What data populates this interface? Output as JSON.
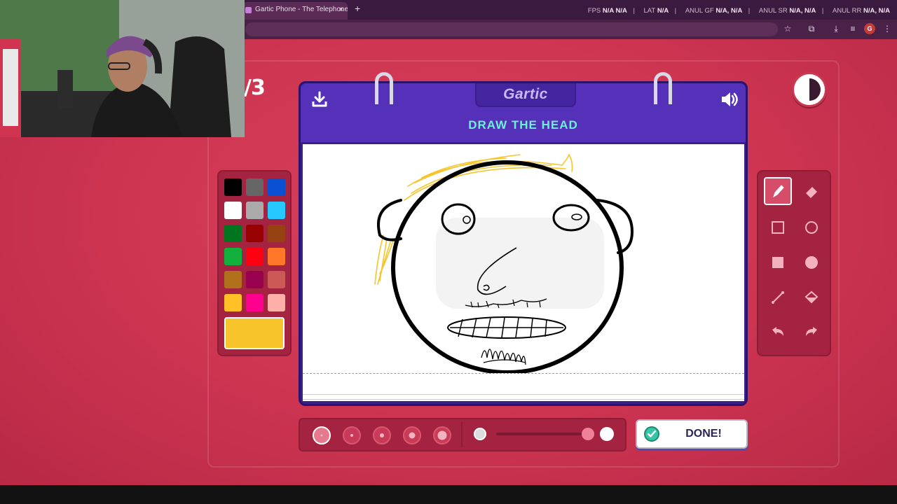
{
  "browser": {
    "tab_title": "Gartic Phone - The Telephone G",
    "tab_close": "×",
    "new_tab": "+",
    "stats": [
      {
        "label": "FPS",
        "value": "N/A  N/A"
      },
      {
        "label": "LAT",
        "value": "N/A"
      },
      {
        "label": "ANUL GF",
        "value": "N/A, N/A"
      },
      {
        "label": "ANUL SR",
        "value": "N/A, N/A"
      },
      {
        "label": "ANUL RR",
        "value": "N/A, N/A"
      }
    ],
    "profile_initial": "G"
  },
  "game": {
    "round_counter": "/3",
    "logo": "Gartic",
    "prompt": "DRAW THE HEAD",
    "done_label": "DONE!",
    "timer_remaining_fraction": 0.5,
    "selected_color": "#f7c52b",
    "palette": [
      "#000000",
      "#666666",
      "#0a50d2",
      "#ffffff",
      "#aaaaaa",
      "#26c9ff",
      "#017420",
      "#990000",
      "#964112",
      "#11b03c",
      "#ff0013",
      "#ff7829",
      "#b0701c",
      "#99004e",
      "#cb5a57",
      "#ffc126",
      "#ff008f",
      "#feafa8"
    ],
    "selected_brush_size_index": 0,
    "opacity_fraction": 0.9
  }
}
